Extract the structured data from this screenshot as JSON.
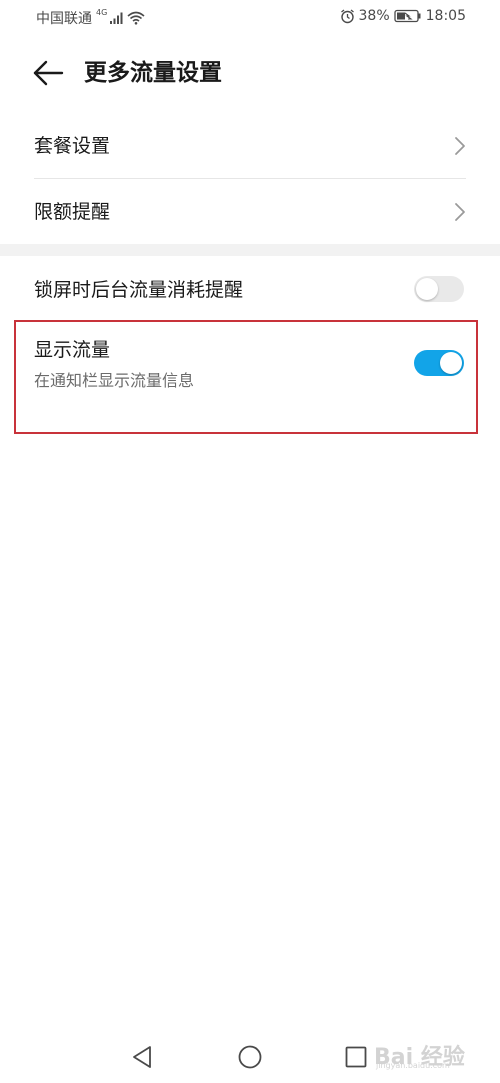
{
  "status_bar": {
    "carrier": "中国联通",
    "network_type": "4G",
    "battery_percent": "38%",
    "time": "18:05"
  },
  "header": {
    "title": "更多流量设置"
  },
  "nav_items": [
    {
      "label": "套餐设置"
    },
    {
      "label": "限额提醒"
    }
  ],
  "toggles": [
    {
      "label": "锁屏时后台流量消耗提醒",
      "state": "off"
    },
    {
      "label": "显示流量",
      "subtitle": "在通知栏显示流量信息",
      "state": "on"
    }
  ],
  "colors": {
    "accent": "#12a4e8",
    "highlight_border": "#c8323a",
    "switch_off": "#e9e9e9",
    "section_gap": "#f2f2f2"
  },
  "watermark": {
    "text": "Bai 经验",
    "url": "jingyan.baidu.com"
  }
}
